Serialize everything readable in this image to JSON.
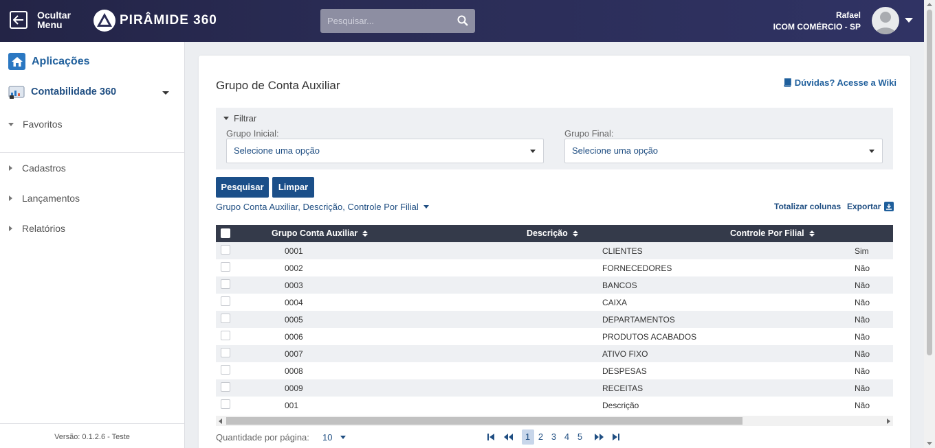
{
  "header": {
    "hide_menu_label": "Ocultar Menu",
    "brand": "PIRÂMIDE 360",
    "search_placeholder": "Pesquisar...",
    "user_name": "Rafael",
    "company": "ICOM COMÉRCIO - SP",
    "bg_color": "#2a2c55"
  },
  "sidebar": {
    "apps_label": "Aplicações",
    "module_label": "Contabilidade 360",
    "favorites_label": "Favoritos",
    "items": [
      {
        "label": "Cadastros"
      },
      {
        "label": "Lançamentos"
      },
      {
        "label": "Relatórios"
      }
    ],
    "version": "Versão: 0.1.2.6 - Teste"
  },
  "page": {
    "title": "Grupo de Conta Auxiliar",
    "wiki_link": "Dúvidas? Acesse a Wiki",
    "filter": {
      "toggle_label": "Filtrar",
      "start_label": "Grupo Inicial:",
      "start_value": "Selecione uma opção",
      "end_label": "Grupo Final:",
      "end_value": "Selecione uma opção"
    },
    "buttons": {
      "search": "Pesquisar",
      "clear": "Limpar"
    },
    "columns_selector": "Grupo Conta Auxiliar, Descrição, Controle Por Filial",
    "totalize": "Totalizar colunas",
    "export": "Exportar",
    "accent_color": "#1b4f89"
  },
  "table": {
    "headers": [
      "Grupo Conta Auxiliar",
      "Descrição",
      "Controle Por Filial"
    ],
    "rows": [
      {
        "grupo": "0001",
        "descricao": "CLIENTES",
        "controle": "Sim"
      },
      {
        "grupo": "0002",
        "descricao": "FORNECEDORES",
        "controle": "Não"
      },
      {
        "grupo": "0003",
        "descricao": "BANCOS",
        "controle": "Não"
      },
      {
        "grupo": "0004",
        "descricao": "CAIXA",
        "controle": "Não"
      },
      {
        "grupo": "0005",
        "descricao": "DEPARTAMENTOS",
        "controle": "Não"
      },
      {
        "grupo": "0006",
        "descricao": "PRODUTOS ACABADOS",
        "controle": "Não"
      },
      {
        "grupo": "0007",
        "descricao": "ATIVO FIXO",
        "controle": "Não"
      },
      {
        "grupo": "0008",
        "descricao": "DESPESAS",
        "controle": "Não"
      },
      {
        "grupo": "0009",
        "descricao": "RECEITAS",
        "controle": "Não"
      },
      {
        "grupo": "001",
        "descricao": "Descrição",
        "controle": "Não"
      }
    ]
  },
  "pagination": {
    "per_page_label": "Quantidade por página:",
    "per_page_value": "10",
    "pages": [
      "1",
      "2",
      "3",
      "4",
      "5"
    ],
    "current_page": "1"
  }
}
